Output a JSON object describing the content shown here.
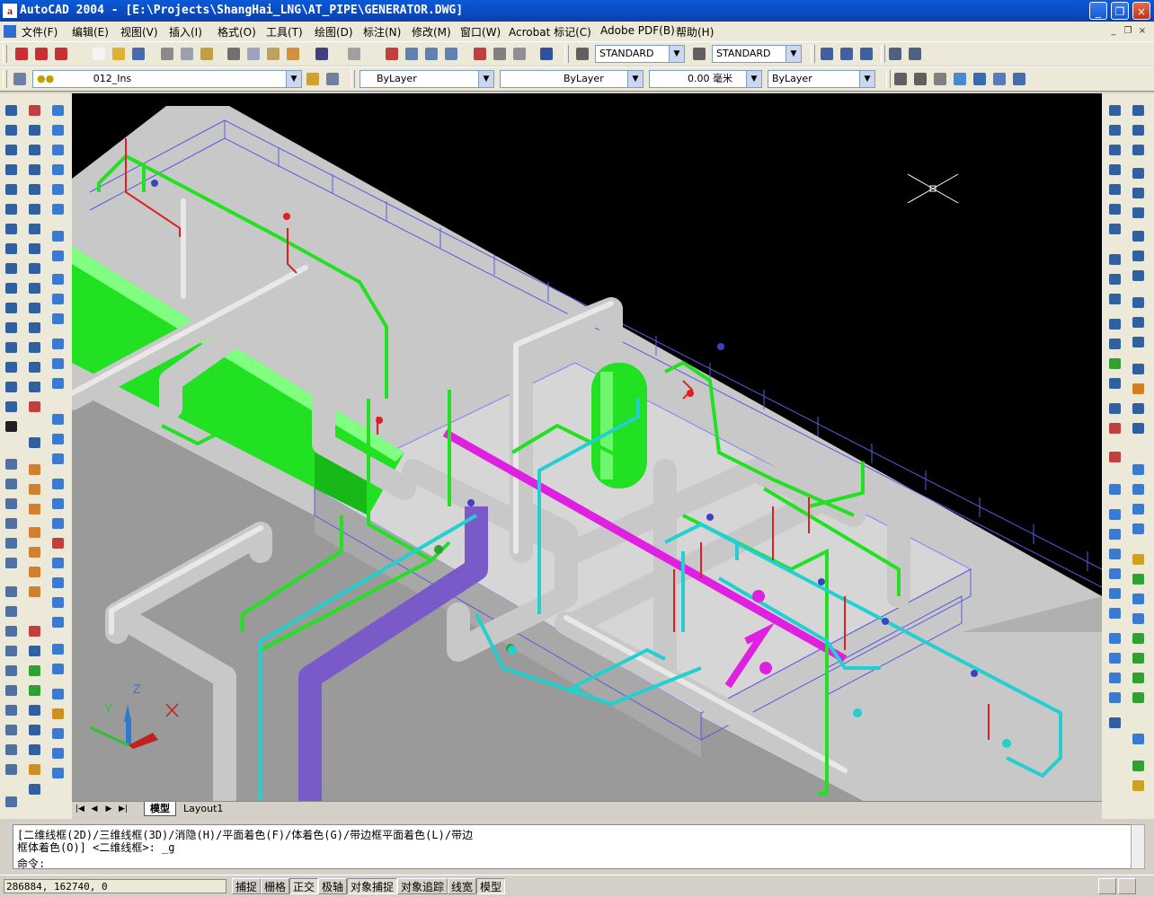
{
  "window": {
    "title": "AutoCAD 2004 - [E:\\Projects\\ShangHai_LNG\\AT_PIPE\\GENERATOR.DWG]",
    "app_icon_letter": "a",
    "minimize": "_",
    "maximize": "❐",
    "close": "×"
  },
  "menu": [
    "文件(F)",
    "编辑(E)",
    "视图(V)",
    "插入(I)",
    "格式(O)",
    "工具(T)",
    "绘图(D)",
    "标注(N)",
    "修改(M)",
    "窗口(W)",
    "Acrobat 标记(C)",
    "Adobe PDF(B)",
    "帮助(H)"
  ],
  "toolbar": {
    "text_style": "STANDARD",
    "dim_style": "STANDARD",
    "layer": "012_Ins",
    "color": "ByLayer",
    "linetype": "ByLayer",
    "lineweight": "0.00 毫米",
    "plot_style": "ByLayer"
  },
  "tabs": {
    "model": "模型",
    "layout1": "Layout1"
  },
  "ucs": {
    "x": "X",
    "y": "Y",
    "z": "Z"
  },
  "command": {
    "line1": "[二维线框(2D)/三维线框(3D)/消隐(H)/平面着色(F)/体着色(G)/带边框平面着色(L)/带边",
    "line2": "框体着色(O)] <二维线框>: _g",
    "prompt": "命令:"
  },
  "status": {
    "coordinates": "286884, 162740, 0",
    "buttons": [
      "捕捉",
      "栅格",
      "正交",
      "极轴",
      "对象捕捉",
      "对象追踪",
      "线宽",
      "模型"
    ],
    "active": [
      "正交",
      "对象捕捉",
      "模型"
    ]
  },
  "colors": {
    "titlebar": "#0a4fc8",
    "pipe_green": "#22e022",
    "pipe_cyan": "#22d0d0",
    "pipe_magenta": "#e020e0",
    "pipe_purple": "#7a5ac8",
    "pipe_gray": "#c8c8c8"
  },
  "icons": {
    "pickbox": "crosshair-cursor-icon"
  }
}
